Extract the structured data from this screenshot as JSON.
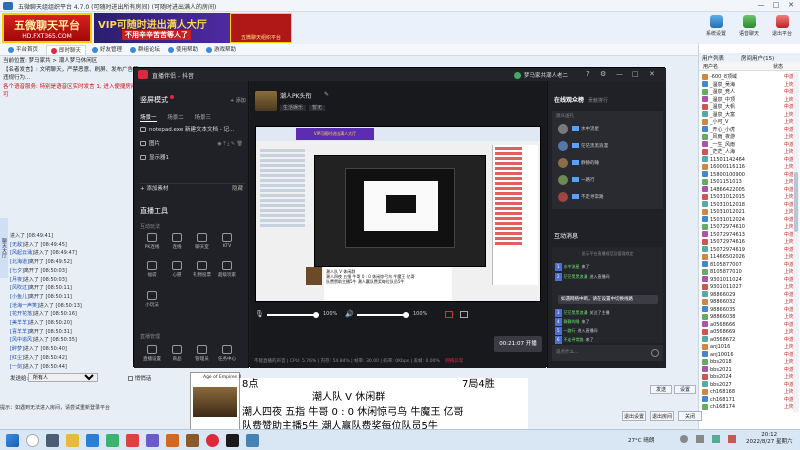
{
  "window": {
    "title": "五微聊天组组织平台 4.7.0 (可随时进出所有房间) (可随时进出满人的房间)",
    "controls": [
      "—",
      "□",
      "✕"
    ]
  },
  "banner": {
    "logo_main": "五微聊天平台",
    "logo_sub": "HD.FXT365.COM",
    "ad_main": "VIP可随时进出满人大厅",
    "ad_sub": "不用辛辛苦苦等人了",
    "ad_small": "五微聊天组织平台",
    "right_buttons": [
      "系统设置",
      "语音聊天",
      "退出平台"
    ]
  },
  "tabs": [
    "平台首页",
    "即时聊天",
    "好友管理",
    "群组论坛",
    "使用帮助",
    "游戏帮助"
  ],
  "info": {
    "line1": "当前位置: 梦马家共 > 潮人梦马休闲区",
    "line2": "【名者发言】: 文明聊天，严禁恶意、刷屏、发布广告等违规行为...",
    "line3": "各个语音服务: 特别是语音区实时发言 1, 进入便捷房间可"
  },
  "left_strip": "聊天大厅",
  "chat_log": [
    {
      "name": "",
      "text": "进入了 [08:49:41]"
    },
    {
      "name": "[无敌]",
      "text": "进入了 [08:49:45]"
    },
    {
      "name": "[风起云涌]",
      "text": "进入了 [08:49:47]"
    },
    {
      "name": "[北海道]",
      "text": "离开了 [08:49:52]"
    },
    {
      "name": "[七夕]",
      "text": "离开了 [08:50:03]"
    },
    {
      "name": "[月夜]",
      "text": "进入了 [08:50:03]"
    },
    {
      "name": "[风吹过]",
      "text": "离开了 [08:50:11]"
    },
    {
      "name": "[小鱼儿]",
      "text": "离开了 [08:50:11]"
    },
    {
      "name": "[沧海一声笑]",
      "text": "进入了 [08:50:13]"
    },
    {
      "name": "[花开花落]",
      "text": "进入了 [08:50:16]"
    },
    {
      "name": "[美羊羊]",
      "text": "进入了 [08:50:20]"
    },
    {
      "name": "[喜羊羊]",
      "text": "离开了 [08:50:31]"
    },
    {
      "name": "[风中追风]",
      "text": "进入了 [08:50:35]"
    },
    {
      "name": "[醉梦]",
      "text": "进入了 [08:50:40]"
    },
    {
      "name": "[红尘]",
      "text": "进入了 [08:50:42]"
    },
    {
      "name": "[一剑]",
      "text": "进入了 [08:50:44]"
    }
  ],
  "input_bar": {
    "label": "发送给:",
    "target": "所有人",
    "checkbox": "悄悄话"
  },
  "bottom_tip": "提示：如遇到无法进入房间，请尝试重新登录平台",
  "right_panel": {
    "tabs": [
      "用户列表",
      "房间用户(15)"
    ],
    "head": [
      "用户名",
      "状态"
    ],
    "users": [
      {
        "name": "-600_8顶域",
        "status": "中游"
      },
      {
        "name": "_温泉_吴海",
        "status": "上岗"
      },
      {
        "name": "_温泉_竞人",
        "status": "中游"
      },
      {
        "name": "_温泉_中顶",
        "status": "上岗"
      },
      {
        "name": "_温泉_大帆",
        "status": "中游"
      },
      {
        "name": "_温泉_大富",
        "status": "上岗"
      },
      {
        "name": "_小可_V",
        "status": "上岗"
      },
      {
        "name": "_开心_小虎",
        "status": "中游"
      },
      {
        "name": "_风雨_夜游",
        "status": "上岗"
      },
      {
        "name": "_一生_风雨",
        "status": "中游"
      },
      {
        "name": "_茫茫_人海",
        "status": "上岗"
      },
      {
        "name": "11501142464",
        "status": "中游"
      },
      {
        "name": "16000116116",
        "status": "上岗"
      },
      {
        "name": "15800100900",
        "status": "中游"
      },
      {
        "name": "1501151013",
        "status": "上岗"
      },
      {
        "name": "14866422005",
        "status": "中游"
      },
      {
        "name": "15031012015",
        "status": "上岗"
      },
      {
        "name": "15031012018",
        "status": "中游"
      },
      {
        "name": "15031012021",
        "status": "上岗"
      },
      {
        "name": "15031012024",
        "status": "中游"
      },
      {
        "name": "15072974610",
        "status": "上岗"
      },
      {
        "name": "15072974613",
        "status": "中游"
      },
      {
        "name": "15072974616",
        "status": "上岗"
      },
      {
        "name": "15072974619",
        "status": "中游"
      },
      {
        "name": "11466502026",
        "status": "上岗"
      },
      {
        "name": "8105877007",
        "status": "中游"
      },
      {
        "name": "8105877010",
        "status": "上岗"
      },
      {
        "name": "9301011024",
        "status": "中游"
      },
      {
        "name": "9301011027",
        "status": "上岗"
      },
      {
        "name": "98866029",
        "status": "中游"
      },
      {
        "name": "98866032",
        "status": "上岗"
      },
      {
        "name": "98866035",
        "status": "中游"
      },
      {
        "name": "98866038",
        "status": "上岗"
      },
      {
        "name": "a0568666",
        "status": "中游"
      },
      {
        "name": "a0568669",
        "status": "上岗"
      },
      {
        "name": "a0568672",
        "status": "中游"
      },
      {
        "name": "anj1016",
        "status": "上岗"
      },
      {
        "name": "anj10016",
        "status": "中游"
      },
      {
        "name": "bbs2018",
        "status": "上岗"
      },
      {
        "name": "bbs2021",
        "status": "中游"
      },
      {
        "name": "bbs2024",
        "status": "上岗"
      },
      {
        "name": "bbs2027",
        "status": "中游"
      },
      {
        "name": "ch168168",
        "status": "上岗"
      },
      {
        "name": "ch168171",
        "status": "中游"
      },
      {
        "name": "ch168174",
        "status": "上岗"
      }
    ]
  },
  "send_buttons": [
    "发送",
    "设置"
  ],
  "bottom_buttons": [
    "退出设置",
    "退出房间",
    "关闭"
  ],
  "studio": {
    "title": "直播伴侣 - 抖音",
    "user": "梦马家共潮人老二",
    "controls": [
      "?",
      "⚙",
      "—",
      "□",
      "✕"
    ],
    "scene_mode": "竖屏模式",
    "add_label": "+ 添加",
    "scene_tabs": [
      "场景一",
      "场景二",
      "场景三"
    ],
    "sources": [
      "notepad.exe 新建文本文档 - 记...",
      "图片",
      "显示器1"
    ],
    "add_source": "+ 添加素材",
    "add_source_right": "隐藏",
    "tools_title": "直播工具",
    "tools_sub": "互动玩法",
    "tools_sub2": "直播管理",
    "tools": [
      {
        "icon": "pk-icon",
        "label": "PK连线"
      },
      {
        "icon": "link-icon",
        "label": "连线"
      },
      {
        "icon": "chat-icon",
        "label": "聊天室"
      },
      {
        "icon": "ktv-icon",
        "label": "KTV"
      },
      {
        "icon": "gift-icon",
        "label": "福袋"
      },
      {
        "icon": "wish-icon",
        "label": "心愿"
      },
      {
        "icon": "fans-icon",
        "label": "礼物投票"
      },
      {
        "icon": "game-icon",
        "label": "超级玩家"
      },
      {
        "icon": "mini-icon",
        "label": "小玩法"
      },
      {
        "icon": "settings-icon",
        "label": "直播设置"
      },
      {
        "icon": "shop-icon",
        "label": "商品"
      },
      {
        "icon": "manage-icon",
        "label": "管理员"
      },
      {
        "icon": "task-icon",
        "label": "任务中心"
      }
    ],
    "live_title": "潮人PK头衔",
    "live_edit": "✎",
    "live_tags": [
      "生活娱乐",
      "暂无"
    ],
    "mic_label": "100%",
    "spk_label": "100%",
    "live_button": "00:21:07 开播",
    "stats": "不能直播的声音 | CPU: 5.76% | 内存: 54.84% | 帧率: 30.00 | 码率: 0Kbps | 丢帧: 0.00%",
    "warn": "网络异常",
    "rank_title": "在线观众榜",
    "rank_tab": "贡献排行",
    "rank_sub": "观众送礼",
    "rank": [
      {
        "name": "水中流星",
        "color": "#7a7a7a"
      },
      {
        "name": "茫茫黑黑浪漫",
        "color": "#5578a8"
      },
      {
        "name": "静静的睡",
        "color": "#8a6e4c"
      },
      {
        "name": "一路行",
        "color": "#6c8a52"
      },
      {
        "name": "不走寻常路",
        "color": "#a04444"
      }
    ],
    "msg_title": "互动消息",
    "msg_sys": "显示平台直播规范及管理规定",
    "msg_notice": "如遇网络中断，请在设置中切换线路",
    "messages": [
      {
        "tag": "1",
        "name": "水中流星",
        "text": "来了"
      },
      {
        "tag": "2",
        "name": "茫茫黑黑浪漫",
        "text": "进入直播间"
      },
      {
        "tag": "3",
        "name": "茫茫黑黑浪漫",
        "text": "关注了主播"
      },
      {
        "tag": "4",
        "name": "静静的睡",
        "text": "来了"
      },
      {
        "tag": "5",
        "name": "一路行",
        "text": "进入直播间"
      },
      {
        "tag": "6",
        "name": "不走寻常路",
        "text": "来了"
      }
    ],
    "msg_input": "说点什么..."
  },
  "aoe": {
    "title": "Age of Empires II"
  },
  "score": {
    "round": "8点",
    "right": "7局4胜",
    "teams": "潮人队 V 休闲群",
    "players": "潮人四夜   五指   牛哥 0 :  0  休闲惊弓鸟  牛魔王  亿哥",
    "sponsor": "队费赞助主播5牛      潮人赢队费奖每位队员5牛"
  },
  "tray": {
    "weather": "27°C 晴朗",
    "time": "20:12",
    "date": "2022/8/27 星期六"
  },
  "colors": {
    "accent": "#2b6cb3",
    "studio_bg": "#1c1d22",
    "live_red": "#e0283d",
    "status_red": "#c01a1a"
  }
}
